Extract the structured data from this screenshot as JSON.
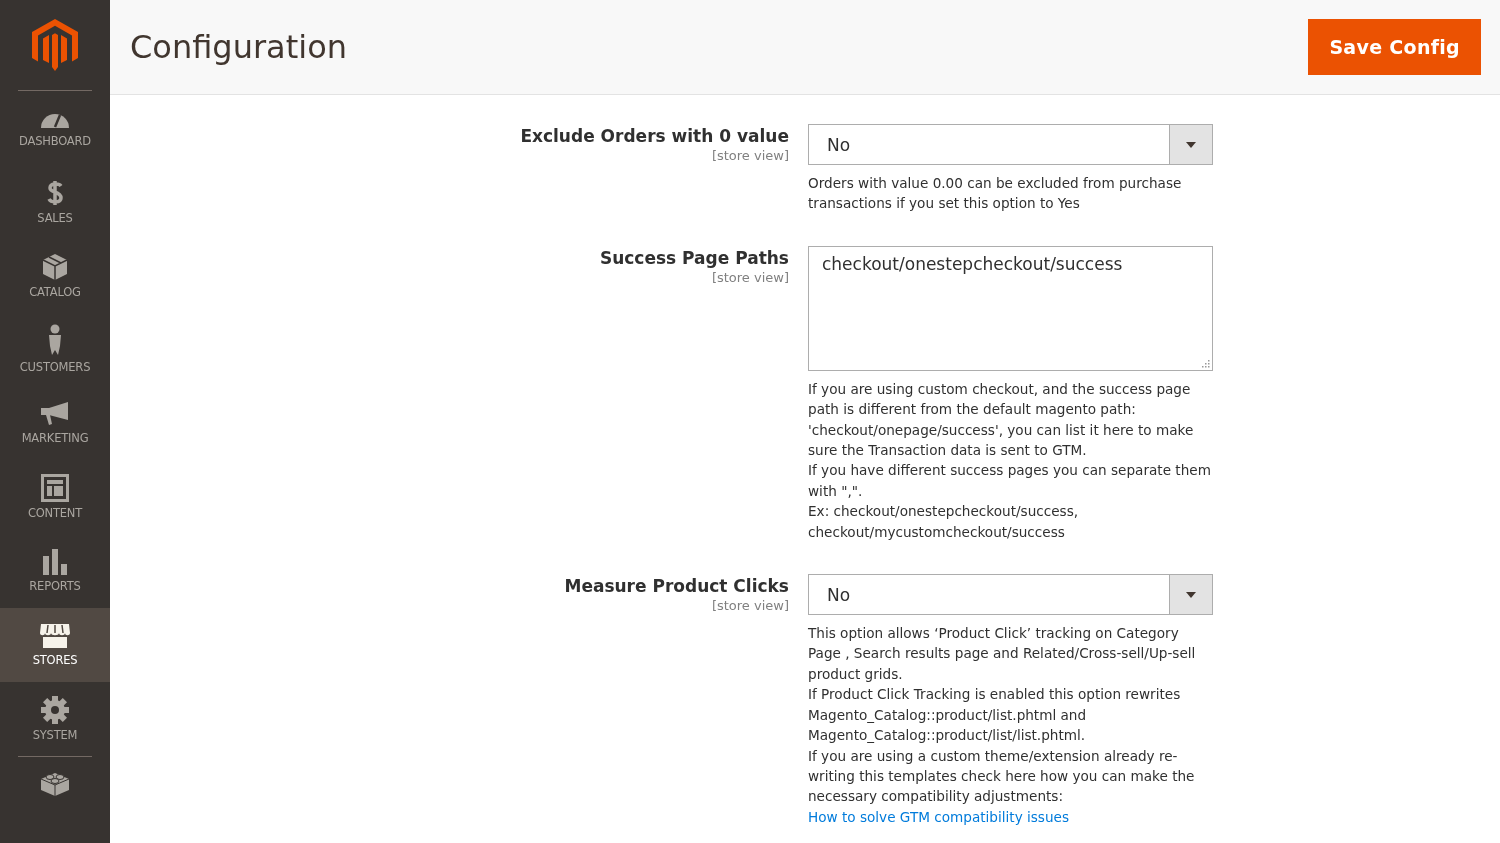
{
  "sidebar": {
    "items": [
      {
        "kind": "dashboard",
        "label": "DASHBOARD",
        "selected": false
      },
      {
        "kind": "sales",
        "label": "SALES",
        "selected": false
      },
      {
        "kind": "catalog",
        "label": "CATALOG",
        "selected": false
      },
      {
        "kind": "customers",
        "label": "CUSTOMERS",
        "selected": false
      },
      {
        "kind": "marketing",
        "label": "MARKETING",
        "selected": false
      },
      {
        "kind": "content",
        "label": "CONTENT",
        "selected": false
      },
      {
        "kind": "reports",
        "label": "REPORTS",
        "selected": false
      },
      {
        "kind": "stores",
        "label": "STORES",
        "selected": true
      },
      {
        "kind": "system",
        "label": "SYSTEM",
        "selected": false
      },
      {
        "kind": "partners",
        "selected": false
      }
    ]
  },
  "header": {
    "title": "Configuration",
    "save_button": "Save Config"
  },
  "fields": [
    {
      "kind": "select",
      "label": "Exclude Orders with 0 value",
      "scope": "[store view]",
      "value": "No",
      "notes": [
        {
          "kind": "text",
          "text": "Orders with value 0.00 can be excluded from purchase transactions if you set this option to Yes"
        }
      ]
    },
    {
      "kind": "textarea",
      "label": "Success Page Paths",
      "scope": "[store view]",
      "value": "checkout/onestepcheckout/success",
      "notes": [
        {
          "kind": "text",
          "text": "If you are using custom checkout, and the success page path is different from the default magento path: 'checkout/onepage/success', you can list it here to make sure the Transaction data is sent to GTM."
        },
        {
          "kind": "text",
          "text": "If you have different success pages you can separate them with \",\"."
        },
        {
          "kind": "text",
          "text": "Ex: checkout/onestepcheckout/success, checkout/mycustomcheckout/success"
        }
      ]
    },
    {
      "kind": "select",
      "label": "Measure Product Clicks",
      "scope": "[store view]",
      "value": "No",
      "notes": [
        {
          "kind": "text",
          "text": "This option allows ‘Product Click’ tracking on Category Page , Search results page and Related/Cross-sell/Up-sell product grids."
        },
        {
          "kind": "text",
          "text": "If Product Click Tracking is enabled this option rewrites Magento_Catalog::product/list.phtml and Magento_Catalog::product/list/list.phtml."
        },
        {
          "kind": "text",
          "text": "If you are using a custom theme/extension already re-writing this templates check here how you can make the necessary compatibility adjustments:"
        },
        {
          "kind": "link",
          "text": "How to solve GTM compatibility issues"
        }
      ]
    }
  ]
}
